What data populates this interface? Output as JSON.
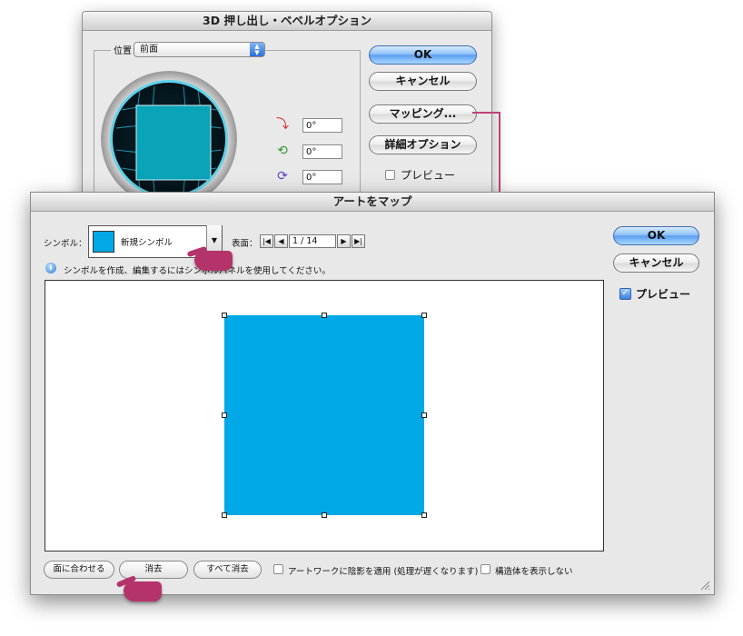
{
  "back_dialog": {
    "title": "3D 押し出し・ベベルオプション",
    "position_label": "位置：",
    "position_value": "前面",
    "rotations": [
      {
        "icon": "x-rotation-icon",
        "value": "0°"
      },
      {
        "icon": "y-rotation-icon",
        "value": "0°"
      },
      {
        "icon": "z-rotation-icon",
        "value": "0°"
      }
    ],
    "ok_label": "OK",
    "cancel_label": "キャンセル",
    "mapping_label": "マッピング...",
    "more_options_label": "詳細オプション",
    "preview_label": "プレビュー",
    "preview_checked": false
  },
  "front_dialog": {
    "title": "アートをマップ",
    "symbol_label": "シンボル：",
    "symbol_value": "新規シンボル",
    "symbol_color": "#00a8e6",
    "surface_label": "表面：",
    "surface_value": "1 / 14",
    "info_text": "シンボルを作成、編集するにはシンボルパネルを使用してください。",
    "ok_label": "OK",
    "cancel_label": "キャンセル",
    "preview_label": "プレビュー",
    "preview_checked": true,
    "scale_to_fit_label": "面に合わせる",
    "clear_label": "消去",
    "clear_all_label": "すべて消去",
    "shade_artwork_label": "アートワークに陰影を適用 (処理が遅くなります)",
    "shade_artwork_checked": false,
    "invisible_geometry_label": "構造体を表示しない",
    "invisible_geometry_checked": false
  },
  "colors": {
    "accent_blue": "#00a8e6",
    "pointer_magenta": "#b5336b"
  }
}
